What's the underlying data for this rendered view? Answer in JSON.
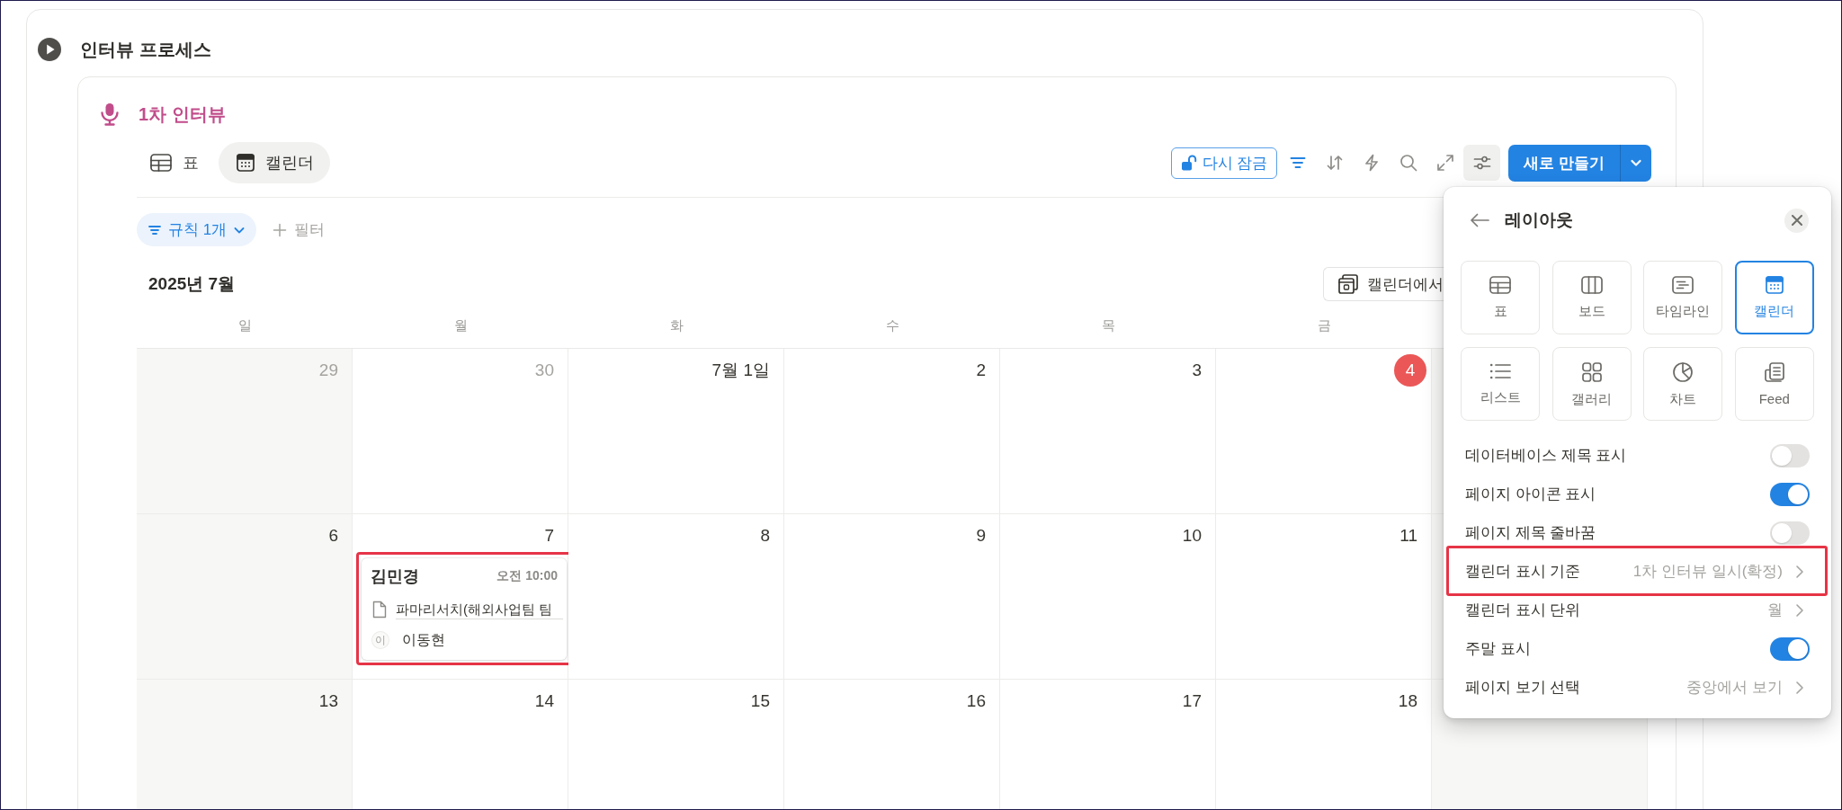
{
  "section": {
    "title": "인터뷰 프로세스"
  },
  "database": {
    "title": "1차 인터뷰",
    "views": [
      {
        "label": "표",
        "kind": "table",
        "selected": false
      },
      {
        "label": "캘린더",
        "kind": "calendar",
        "selected": true
      }
    ]
  },
  "toolbar": {
    "lock_label": "다시 잠금",
    "filter_active": true,
    "settings_open": true,
    "new_label": "새로 만들기"
  },
  "filters": {
    "rule_chip": "규칙 1개",
    "add_filter": "필터"
  },
  "calendar": {
    "month": "2025년 7월",
    "open_button": "캘린더에서",
    "weekdays": [
      "일",
      "월",
      "화",
      "수",
      "목",
      "금"
    ],
    "weeks": [
      {
        "days": [
          {
            "label": "29",
            "outside": true,
            "today": false
          },
          {
            "label": "30",
            "outside": true,
            "today": false
          },
          {
            "label": "7월 1일",
            "outside": false,
            "today": false
          },
          {
            "label": "2",
            "outside": false,
            "today": false
          },
          {
            "label": "3",
            "outside": false,
            "today": false
          },
          {
            "label": "4",
            "outside": false,
            "today": true
          }
        ]
      },
      {
        "days": [
          {
            "label": "6",
            "outside": false,
            "today": false
          },
          {
            "label": "7",
            "outside": false,
            "today": false,
            "events": [
              {
                "title": "김민경",
                "time": "오전 10:00",
                "page": "파마리서치(해외사업팀 팀",
                "person_initial": "이",
                "person": "이동현",
                "highlighted": true
              }
            ]
          },
          {
            "label": "8",
            "outside": false,
            "today": false
          },
          {
            "label": "9",
            "outside": false,
            "today": false
          },
          {
            "label": "10",
            "outside": false,
            "today": false
          },
          {
            "label": "11",
            "outside": false,
            "today": false
          }
        ]
      },
      {
        "days": [
          {
            "label": "13",
            "outside": false,
            "today": false
          },
          {
            "label": "14",
            "outside": false,
            "today": false
          },
          {
            "label": "15",
            "outside": false,
            "today": false
          },
          {
            "label": "16",
            "outside": false,
            "today": false
          },
          {
            "label": "17",
            "outside": false,
            "today": false
          },
          {
            "label": "18",
            "outside": false,
            "today": false
          }
        ]
      }
    ]
  },
  "layout_panel": {
    "title": "레이아웃",
    "layouts": [
      {
        "label": "표",
        "kind": "table",
        "selected": false
      },
      {
        "label": "보드",
        "kind": "board",
        "selected": false
      },
      {
        "label": "타임라인",
        "kind": "timeline",
        "selected": false
      },
      {
        "label": "캘린더",
        "kind": "calendar",
        "selected": true
      },
      {
        "label": "리스트",
        "kind": "list",
        "selected": false
      },
      {
        "label": "갤러리",
        "kind": "gallery",
        "selected": false
      },
      {
        "label": "차트",
        "kind": "chart",
        "selected": false
      },
      {
        "label": "Feed",
        "kind": "feed",
        "selected": false
      }
    ],
    "settings": [
      {
        "label": "데이터베이스 제목 표시",
        "kind": "toggle",
        "on": false,
        "highlighted": false
      },
      {
        "label": "페이지 아이콘 표시",
        "kind": "toggle",
        "on": true,
        "highlighted": false
      },
      {
        "label": "페이지 제목 줄바꿈",
        "kind": "toggle",
        "on": false,
        "highlighted": false
      },
      {
        "label": "캘린더 표시 기준",
        "kind": "select",
        "value": "1차 인터뷰 일시(확정)",
        "highlighted": true
      },
      {
        "label": "캘린더 표시 단위",
        "kind": "select",
        "value": "월",
        "highlighted": false
      },
      {
        "label": "주말 표시",
        "kind": "toggle",
        "on": true,
        "highlighted": false
      },
      {
        "label": "페이지 보기 선택",
        "kind": "select",
        "value": "중앙에서 보기",
        "highlighted": false
      }
    ]
  }
}
